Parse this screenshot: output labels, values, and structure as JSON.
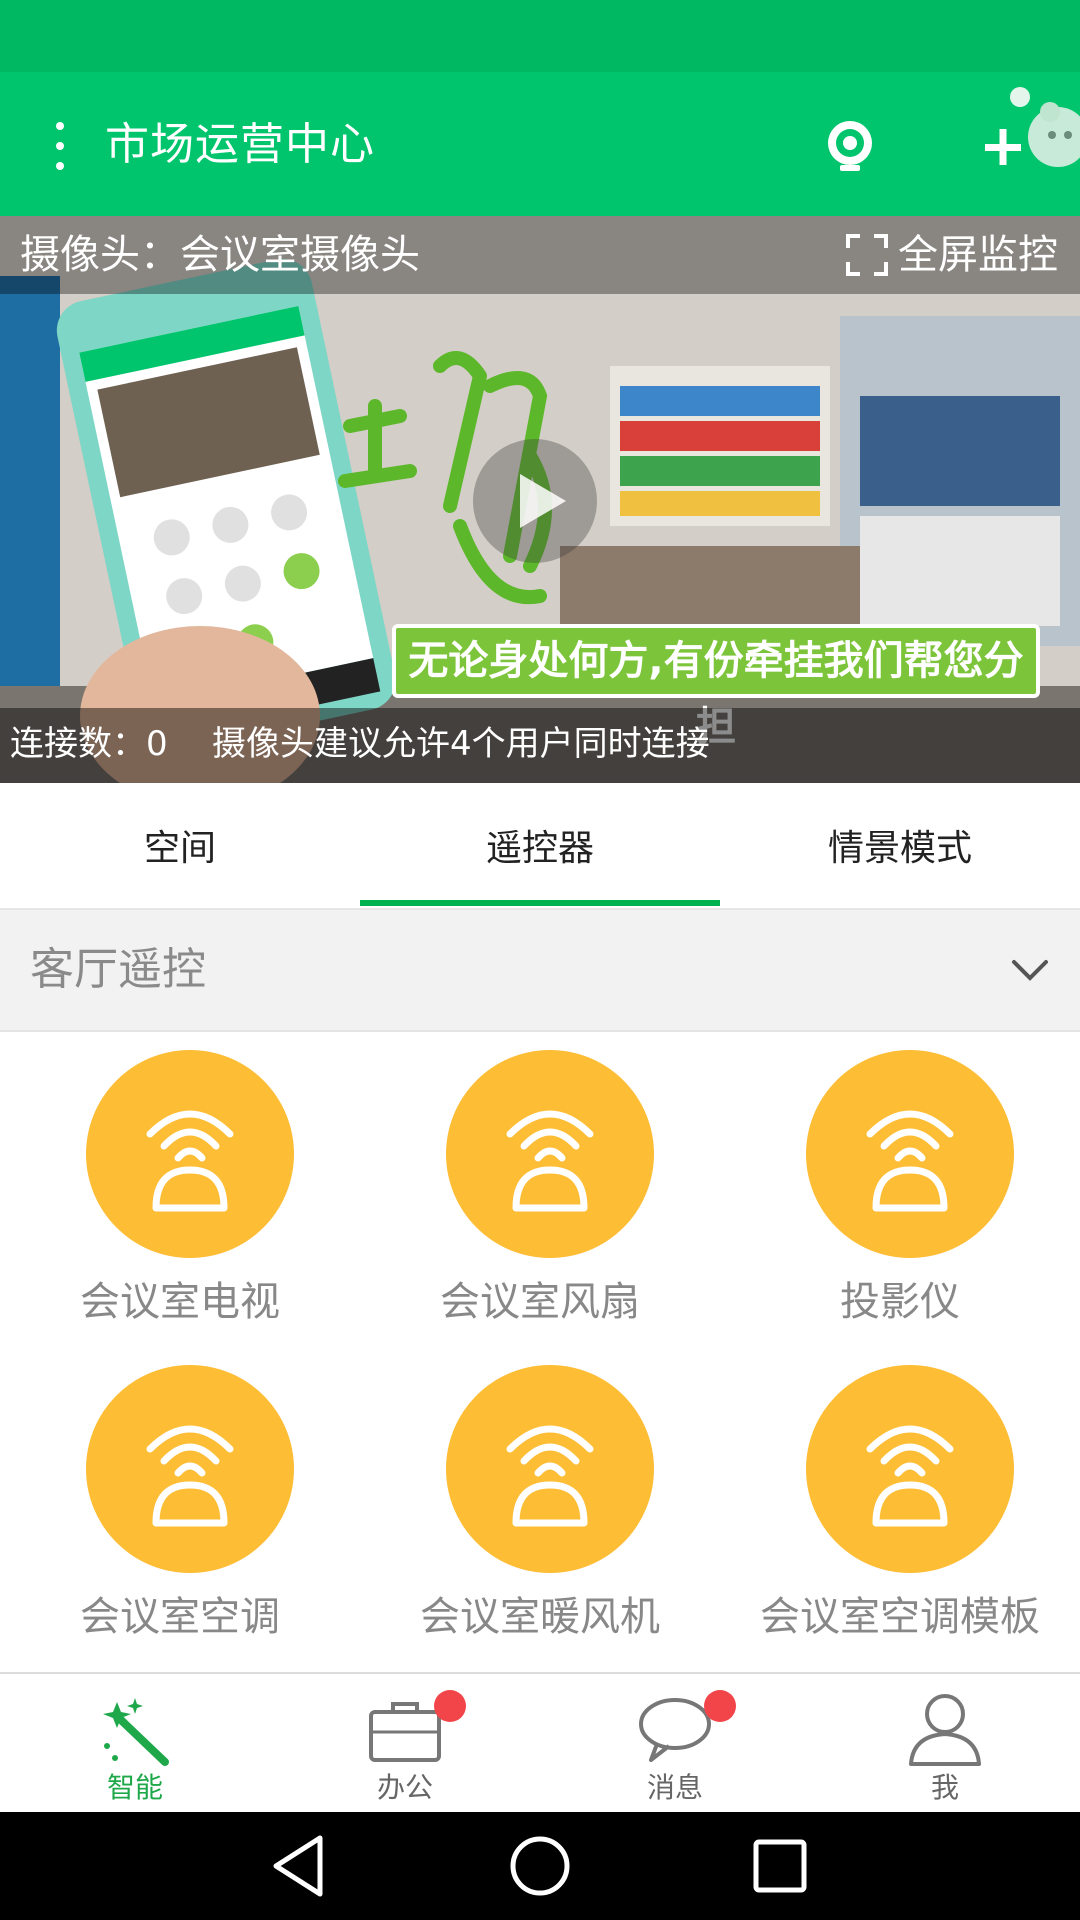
{
  "app": {
    "title": "市场运营中心"
  },
  "video": {
    "camera_label": "摄像头：会议室摄像头",
    "fullscreen_label": "全屏监控",
    "connections_label": "连接数：0",
    "connection_hint": "摄像头建议允许4个用户同时连接",
    "slogan": "无论身处何方,有份牵挂我们帮您分担"
  },
  "tabs": [
    {
      "label": "空间"
    },
    {
      "label": "遥控器",
      "active": true
    },
    {
      "label": "情景模式"
    }
  ],
  "section": {
    "title": "客厅遥控"
  },
  "remotes": [
    {
      "label": "会议室电视"
    },
    {
      "label": "会议室风扇"
    },
    {
      "label": "投影仪"
    },
    {
      "label": "会议室空调"
    },
    {
      "label": "会议室暖风机"
    },
    {
      "label": "会议室空调模板"
    }
  ],
  "bottom_nav": [
    {
      "label": "智能",
      "icon": "magic-wand-icon",
      "active": true
    },
    {
      "label": "办公",
      "icon": "briefcase-icon",
      "badge": true
    },
    {
      "label": "消息",
      "icon": "chat-bubble-icon",
      "badge": true
    },
    {
      "label": "我",
      "icon": "user-icon"
    }
  ],
  "colors": {
    "primary_green": "#00c56d",
    "status_green": "#00b862",
    "tab_indicator": "#00b14f",
    "remote_circle": "#fdbd35",
    "badge_red": "#f2454a"
  }
}
